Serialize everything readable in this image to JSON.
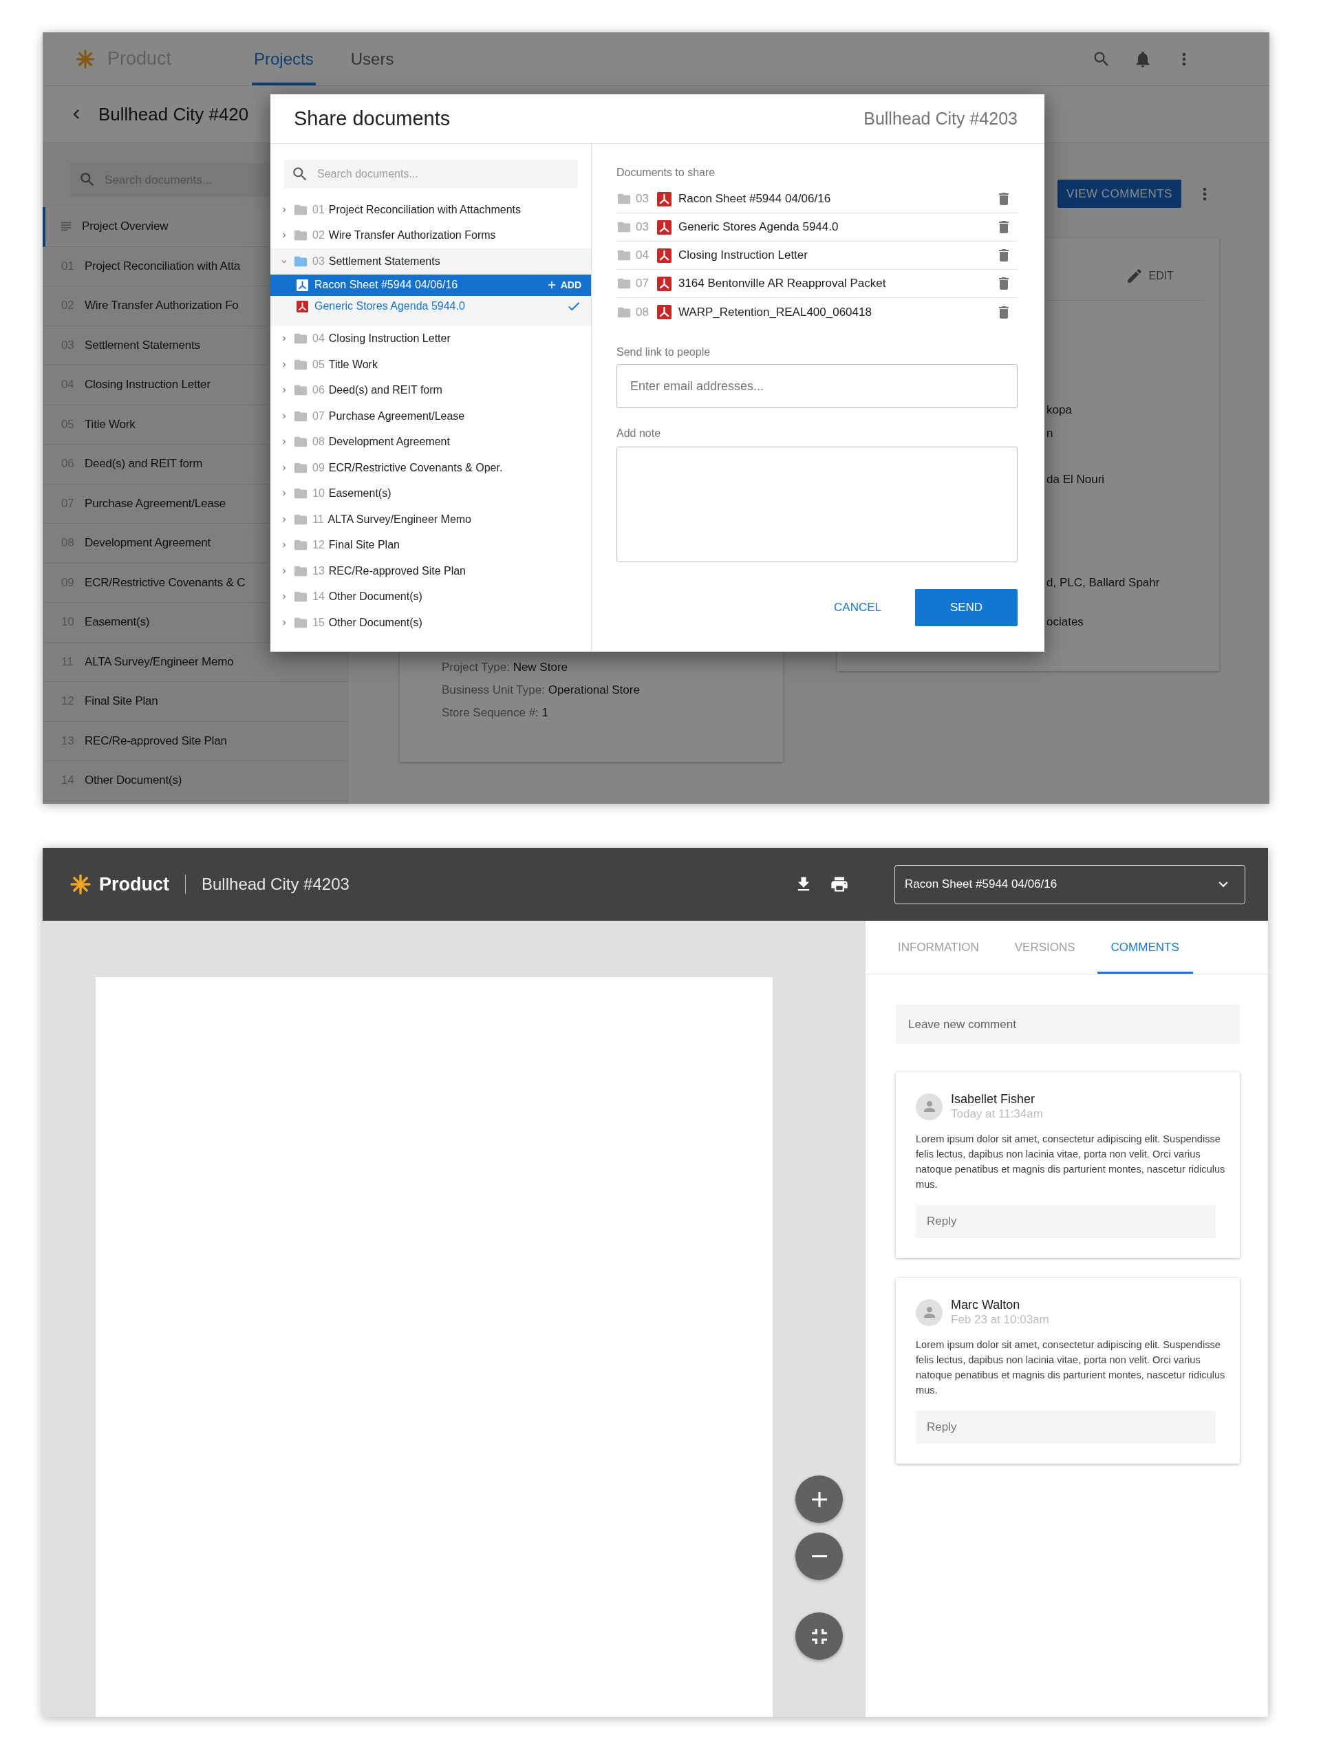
{
  "background_app": {
    "header": {
      "logo": "Product",
      "tabs": [
        {
          "label": "Projects",
          "selected": true
        },
        {
          "label": "Users",
          "selected": false
        }
      ]
    },
    "page_title": "Bullhead City #420",
    "sidebar": {
      "search_placeholder": "Search documents...",
      "items": [
        {
          "kind": "overview",
          "label": "Project Overview",
          "selected": true
        },
        {
          "kind": "folder",
          "number": "01",
          "label": "Project Reconciliation with Atta",
          "selected": false
        },
        {
          "kind": "folder",
          "number": "02",
          "label": "Wire Transfer Authorization Fo",
          "selected": false
        },
        {
          "kind": "folder",
          "number": "03",
          "label": "Settlement Statements",
          "selected": false
        },
        {
          "kind": "folder",
          "number": "04",
          "label": "Closing Instruction Letter",
          "selected": false
        },
        {
          "kind": "folder",
          "number": "05",
          "label": "Title Work",
          "selected": false
        },
        {
          "kind": "folder",
          "number": "06",
          "label": "Deed(s) and REIT form",
          "selected": false
        },
        {
          "kind": "folder",
          "number": "07",
          "label": "Purchase Agreement/Lease",
          "selected": false
        },
        {
          "kind": "folder",
          "number": "08",
          "label": "Development Agreement",
          "selected": false
        },
        {
          "kind": "folder",
          "number": "09",
          "label": "ECR/Restrictive Covenants & C",
          "selected": false
        },
        {
          "kind": "folder",
          "number": "10",
          "label": "Easement(s)",
          "selected": false
        },
        {
          "kind": "folder",
          "number": "11",
          "label": "ALTA Survey/Engineer Memo",
          "selected": false
        },
        {
          "kind": "folder",
          "number": "12",
          "label": "Final Site Plan",
          "selected": false
        },
        {
          "kind": "folder",
          "number": "13",
          "label": "REC/Re-approved Site Plan",
          "selected": false
        },
        {
          "kind": "folder",
          "number": "14",
          "label": "Other Document(s)",
          "selected": false
        }
      ]
    },
    "view_comments_button": "VIEW COMMENTS",
    "details_card": {
      "fields": [
        {
          "label": "Project Type:",
          "value": "New Store"
        },
        {
          "label": "Business Unit Type:",
          "value": "Operational Store"
        },
        {
          "label": "Store Sequence #:",
          "value": "1"
        }
      ]
    },
    "info_card": {
      "edit_button": "EDIT",
      "fragments": [
        "kopa",
        "n",
        "da El Nouri",
        "d, PLC, Ballard Spahr",
        "ociates"
      ]
    }
  },
  "share_dialog": {
    "title": "Share documents",
    "project": "Bullhead City #4203",
    "search_placeholder": "Search documents...",
    "folders": [
      {
        "number": "01",
        "label": "Project Reconciliation with Attachments",
        "expanded": false
      },
      {
        "number": "02",
        "label": "Wire Transfer Authorization Forms",
        "expanded": false
      },
      {
        "number": "03",
        "label": "Settlement Statements",
        "expanded": true,
        "children": [
          {
            "label": "Racon Sheet #5944 04/06/16",
            "selected": true,
            "added": false,
            "action": "ADD"
          },
          {
            "label": "Generic Stores Agenda 5944.0",
            "selected": false,
            "added": true
          }
        ]
      },
      {
        "number": "04",
        "label": "Closing Instruction Letter",
        "expanded": false
      },
      {
        "number": "05",
        "label": "Title Work",
        "expanded": false
      },
      {
        "number": "06",
        "label": "Deed(s) and REIT form",
        "expanded": false
      },
      {
        "number": "07",
        "label": "Purchase Agreement/Lease",
        "expanded": false
      },
      {
        "number": "08",
        "label": "Development Agreement",
        "expanded": false
      },
      {
        "number": "09",
        "label": "ECR/Restrictive Covenants & Oper.",
        "expanded": false
      },
      {
        "number": "10",
        "label": "Easement(s)",
        "expanded": false
      },
      {
        "number": "11",
        "label": "ALTA Survey/Engineer Memo",
        "expanded": false
      },
      {
        "number": "12",
        "label": "Final Site Plan",
        "expanded": false
      },
      {
        "number": "13",
        "label": "REC/Re-approved Site Plan",
        "expanded": false
      },
      {
        "number": "14",
        "label": "Other Document(s)",
        "expanded": false
      },
      {
        "number": "15",
        "label": "Other Document(s)",
        "expanded": false
      }
    ],
    "documents_label": "Documents to share",
    "documents": [
      {
        "folder": "03",
        "name": "Racon Sheet #5944 04/06/16"
      },
      {
        "folder": "03",
        "name": "Generic Stores Agenda 5944.0"
      },
      {
        "folder": "04",
        "name": "Closing Instruction Letter"
      },
      {
        "folder": "07",
        "name": "3164 Bentonville AR Reapproval Packet"
      },
      {
        "folder": "08",
        "name": "WARP_Retention_REAL400_060418"
      }
    ],
    "send_link": {
      "label": "Send link to people",
      "placeholder": "Enter email addresses..."
    },
    "note": {
      "label": "Add note"
    },
    "cancel_button": "CANCEL",
    "send_button": "SEND"
  },
  "viewer": {
    "header": {
      "logo": "Product",
      "title": "Bullhead City #4203",
      "document_select": "Racon Sheet #5944 04/06/16"
    },
    "tabs": [
      {
        "label": "INFORMATION",
        "selected": false
      },
      {
        "label": "VERSIONS",
        "selected": false
      },
      {
        "label": "COMMENTS",
        "selected": true
      }
    ],
    "new_comment_placeholder": "Leave new comment",
    "comments": [
      {
        "author": "Isabellet Fisher",
        "time": "Today at 11:34am",
        "text": "Lorem ipsum dolor sit amet, consectetur adipiscing elit. Suspendisse felis lectus, dapibus non lacinia vitae, porta non velit. Orci varius natoque penatibus et magnis dis parturient montes, nascetur ridiculus mus.",
        "reply_placeholder": "Reply"
      },
      {
        "author": "Marc Walton",
        "time": "Feb 23 at 10:03am",
        "text": "Lorem ipsum dolor sit amet, consectetur adipiscing elit. Suspendisse felis lectus, dapibus non lacinia vitae, porta non velit. Orci varius natoque penatibus et magnis dis parturient montes, nascetur ridiculus mus.",
        "reply_placeholder": "Reply"
      }
    ]
  }
}
